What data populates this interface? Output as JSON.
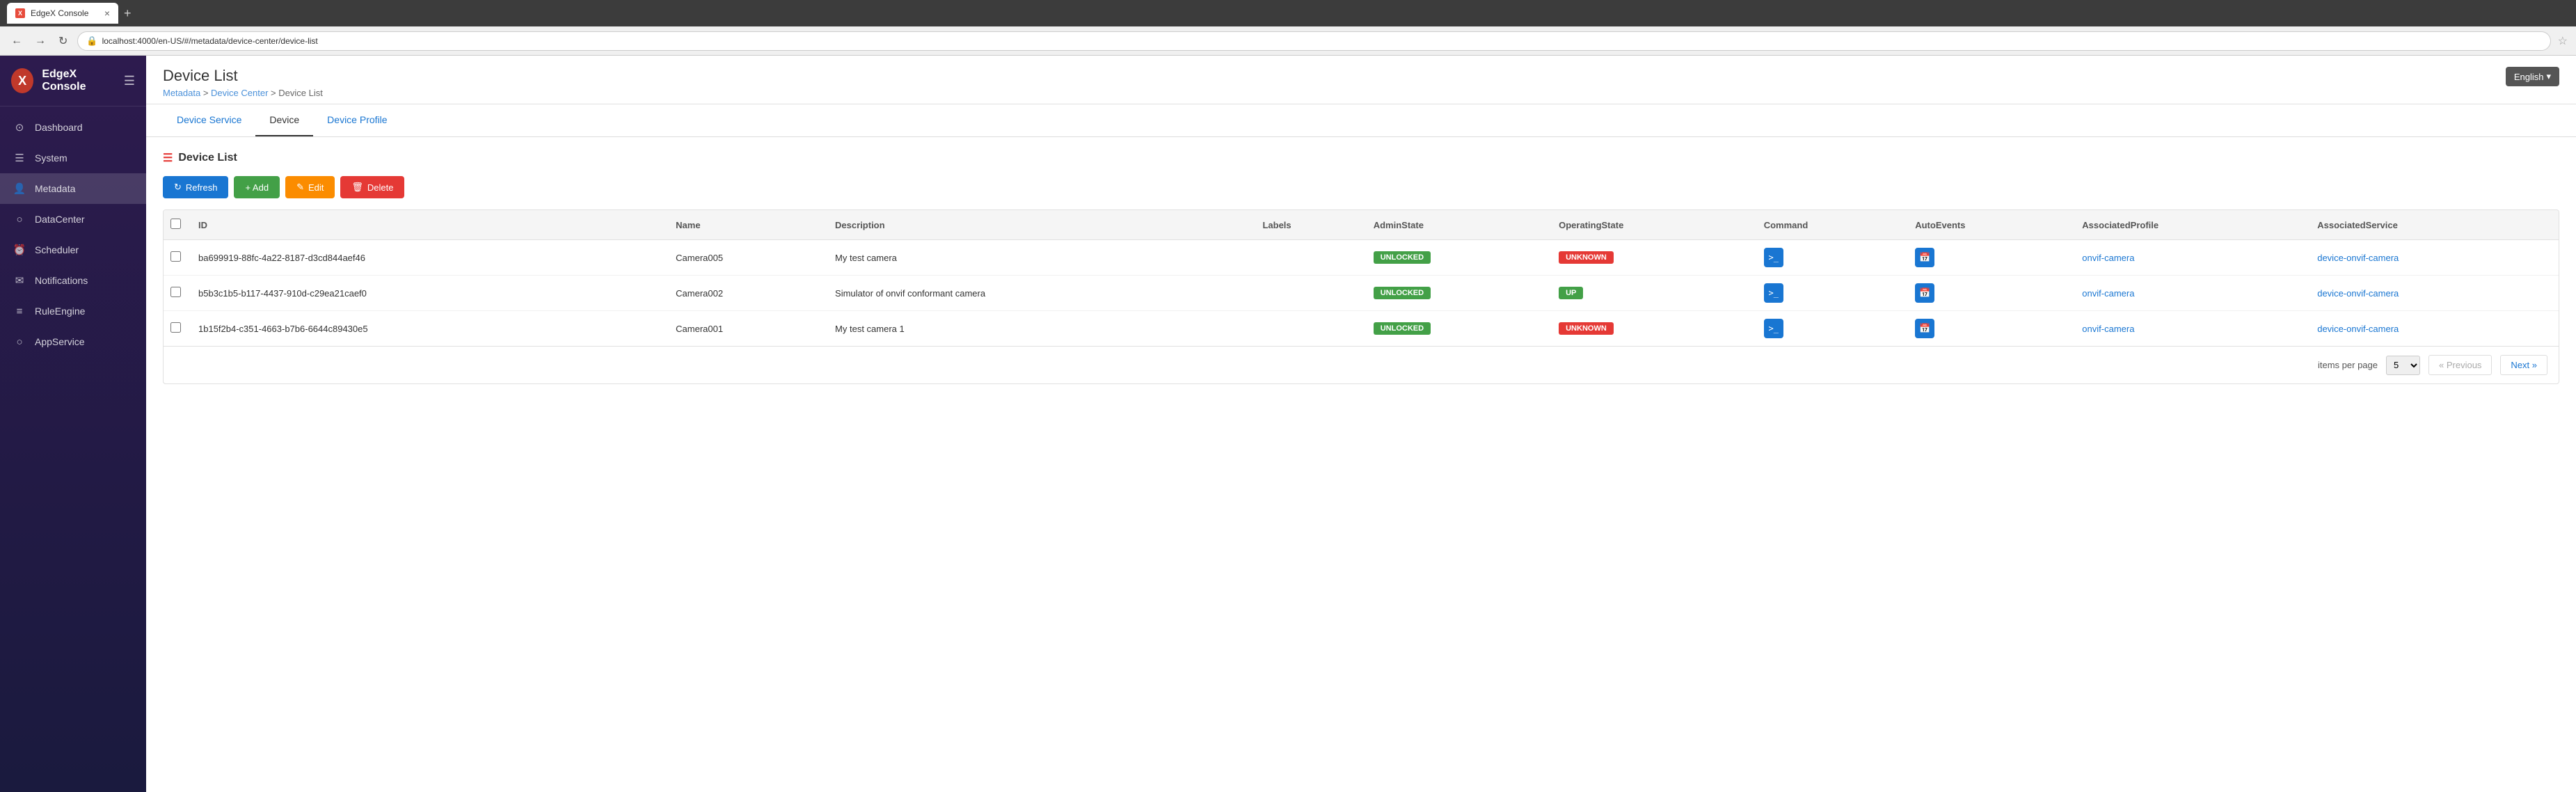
{
  "browser": {
    "tab_title": "EdgeX Console",
    "tab_favicon": "X",
    "url": "localhost:4000/en-US/#/metadata/device-center/device-list",
    "close_icon": "×",
    "new_tab_icon": "+"
  },
  "header": {
    "page_title": "Device List",
    "breadcrumb": [
      "Metadata",
      "Device Center",
      "Device List"
    ],
    "lang_label": "English",
    "lang_icon": "▾"
  },
  "sidebar": {
    "logo_letter": "X",
    "app_name": "EdgeX Console",
    "menu_icon": "☰",
    "items": [
      {
        "id": "dashboard",
        "label": "Dashboard",
        "icon": "⊙"
      },
      {
        "id": "system",
        "label": "System",
        "icon": "☰"
      },
      {
        "id": "metadata",
        "label": "Metadata",
        "icon": "👤",
        "active": true
      },
      {
        "id": "datacenter",
        "label": "DataCenter",
        "icon": "○"
      },
      {
        "id": "scheduler",
        "label": "Scheduler",
        "icon": "⏰"
      },
      {
        "id": "notifications",
        "label": "Notifications",
        "icon": "✉"
      },
      {
        "id": "ruleengine",
        "label": "RuleEngine",
        "icon": "≡"
      },
      {
        "id": "appservice",
        "label": "AppService",
        "icon": "○"
      }
    ]
  },
  "tabs": [
    {
      "id": "device-service",
      "label": "Device Service",
      "active": false,
      "blue": true
    },
    {
      "id": "device",
      "label": "Device",
      "active": true,
      "blue": false
    },
    {
      "id": "device-profile",
      "label": "Device Profile",
      "active": false,
      "blue": true
    }
  ],
  "toolbar": {
    "refresh_label": "Refresh",
    "add_label": "+ Add",
    "edit_label": "Edit",
    "delete_label": "Delete",
    "refresh_icon": "↻",
    "edit_icon": "✎",
    "delete_icon": "🗑"
  },
  "section": {
    "title": "Device List",
    "icon": "☰"
  },
  "table": {
    "columns": [
      "ID",
      "Name",
      "Description",
      "Labels",
      "AdminState",
      "OperatingState",
      "Command",
      "AutoEvents",
      "AssociatedProfile",
      "AssociatedService"
    ],
    "rows": [
      {
        "id": "ba699919-88fc-4a22-8187-d3cd844aef46",
        "name": "Camera005",
        "description": "My test camera",
        "labels": "",
        "admin_state": "UNLOCKED",
        "operating_state": "UNKNOWN",
        "associated_profile": "onvif-camera",
        "associated_service": "device-onvif-camera"
      },
      {
        "id": "b5b3c1b5-b117-4437-910d-c29ea21caef0",
        "name": "Camera002",
        "description": "Simulator of onvif conformant camera",
        "labels": "",
        "admin_state": "UNLOCKED",
        "operating_state": "UP",
        "associated_profile": "onvif-camera",
        "associated_service": "device-onvif-camera"
      },
      {
        "id": "1b15f2b4-c351-4663-b7b6-6644c89430e5",
        "name": "Camera001",
        "description": "My test camera 1",
        "labels": "",
        "admin_state": "UNLOCKED",
        "operating_state": "UNKNOWN",
        "associated_profile": "onvif-camera",
        "associated_service": "device-onvif-camera"
      }
    ]
  },
  "pagination": {
    "items_per_page_label": "items per page",
    "items_per_page_value": "5",
    "prev_label": "« Previous",
    "next_label": "Next »"
  }
}
